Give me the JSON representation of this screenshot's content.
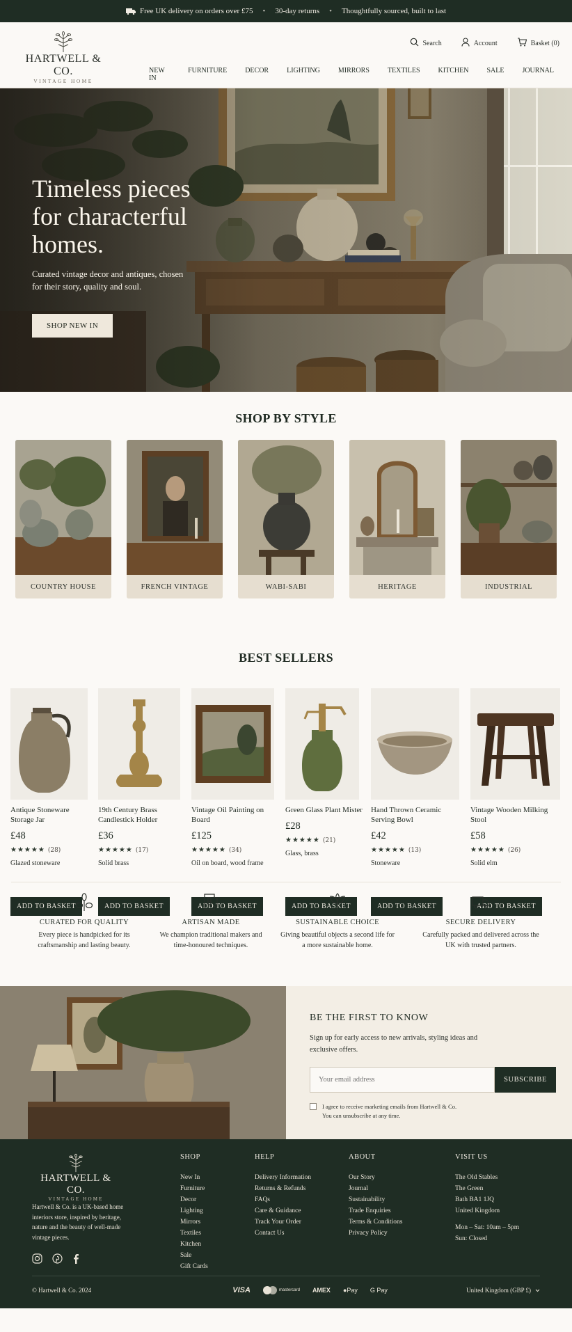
{
  "topbar": {
    "items": [
      "Free UK delivery on orders over £75",
      "30-day returns",
      "Thoughtfully sourced, built to last"
    ],
    "separator": "•"
  },
  "header": {
    "logo_name": "HARTWELL & CO.",
    "logo_sub": "VINTAGE HOME",
    "tools": {
      "search": "Search",
      "account": "Account",
      "basket": "Basket (0)"
    },
    "nav": [
      "NEW IN",
      "FURNITURE",
      "DECOR",
      "LIGHTING",
      "MIRRORS",
      "TEXTILES",
      "KITCHEN",
      "SALE",
      "JOURNAL"
    ]
  },
  "hero": {
    "title": "Timeless pieces for characterful homes.",
    "subtitle": "Curated vintage decor and antiques, chosen for their story, quality and soul.",
    "cta": "SHOP NEW IN"
  },
  "styles": {
    "title": "SHOP BY STYLE",
    "items": [
      "COUNTRY HOUSE",
      "FRENCH VINTAGE",
      "WABI-SABI",
      "HERITAGE",
      "INDUSTRIAL"
    ]
  },
  "best_sellers": {
    "title": "BEST SELLERS",
    "add_label": "ADD TO BASKET",
    "products": [
      {
        "name": "Antique Stoneware Storage Jar",
        "price": "£48",
        "stars": "★★★★★",
        "count": "(28)",
        "material": "Glazed stoneware"
      },
      {
        "name": "19th Century Brass Candlestick Holder",
        "price": "£36",
        "stars": "★★★★★",
        "count": "(17)",
        "material": "Solid brass"
      },
      {
        "name": "Vintage Oil Painting on Board",
        "price": "£125",
        "stars": "★★★★★",
        "count": "(34)",
        "material": "Oil on board, wood frame"
      },
      {
        "name": "Green Glass Plant Mister",
        "price": "£28",
        "stars": "★★★★★",
        "count": "(21)",
        "material": "Glass, brass"
      },
      {
        "name": "Hand Thrown Ceramic Serving Bowl",
        "price": "£42",
        "stars": "★★★★★",
        "count": "(13)",
        "material": "Stoneware"
      },
      {
        "name": "Vintage Wooden Milking Stool",
        "price": "£58",
        "stars": "★★★★★",
        "count": "(26)",
        "material": "Solid elm"
      }
    ]
  },
  "features": [
    {
      "icon": "flower-icon",
      "title": "CURATED FOR QUALITY",
      "text": "Every piece is handpicked for its craftsmanship and lasting beauty."
    },
    {
      "icon": "jug-icon",
      "title": "ARTISAN MADE",
      "text": "We champion traditional makers and time-honoured techniques."
    },
    {
      "icon": "leaf-icon",
      "title": "SUSTAINABLE CHOICE",
      "text": "Giving beautiful objects a second life for a more sustainable home."
    },
    {
      "icon": "truck-icon",
      "title": "SECURE DELIVERY",
      "text": "Carefully packed and delivered across the UK with trusted partners."
    }
  ],
  "newsletter": {
    "title": "BE THE FIRST TO KNOW",
    "text": "Sign up for early access to new arrivals, styling ideas and exclusive offers.",
    "placeholder": "Your email address",
    "button": "SUBSCRIBE",
    "consent_1": "I agree to receive marketing emails from Hartwell & Co.",
    "consent_2": "You can unsubscribe at any time."
  },
  "footer": {
    "logo_name": "HARTWELL & CO.",
    "logo_sub": "VINTAGE HOME",
    "about": "Hartwell & Co. is a UK-based home interiors store, inspired by heritage, nature and the beauty of well-made vintage pieces.",
    "shop": {
      "title": "SHOP",
      "links": [
        "New In",
        "Furniture",
        "Decor",
        "Lighting",
        "Mirrors",
        "Textiles",
        "Kitchen",
        "Sale",
        "Gift Cards"
      ]
    },
    "help": {
      "title": "HELP",
      "links": [
        "Delivery Information",
        "Returns & Refunds",
        "FAQs",
        "Care & Guidance",
        "Track Your Order",
        "Contact Us"
      ]
    },
    "about_col": {
      "title": "ABOUT",
      "links": [
        "Our Story",
        "Journal",
        "Sustainability",
        "Trade Enquiries",
        "Terms & Conditions",
        "Privacy Policy"
      ]
    },
    "visit": {
      "title": "VISIT US",
      "lines": [
        "The Old Stables",
        "The Green",
        "Bath BA1 1JQ",
        "United Kingdom",
        "",
        "Mon – Sat: 10am – 5pm",
        "Sun: Closed"
      ]
    },
    "copyright": "© Hartwell & Co. 2024",
    "payments": [
      "VISA",
      "mastercard",
      "AMEX",
      "Pay",
      "G Pay"
    ],
    "region": "United Kingdom (GBP £)"
  }
}
